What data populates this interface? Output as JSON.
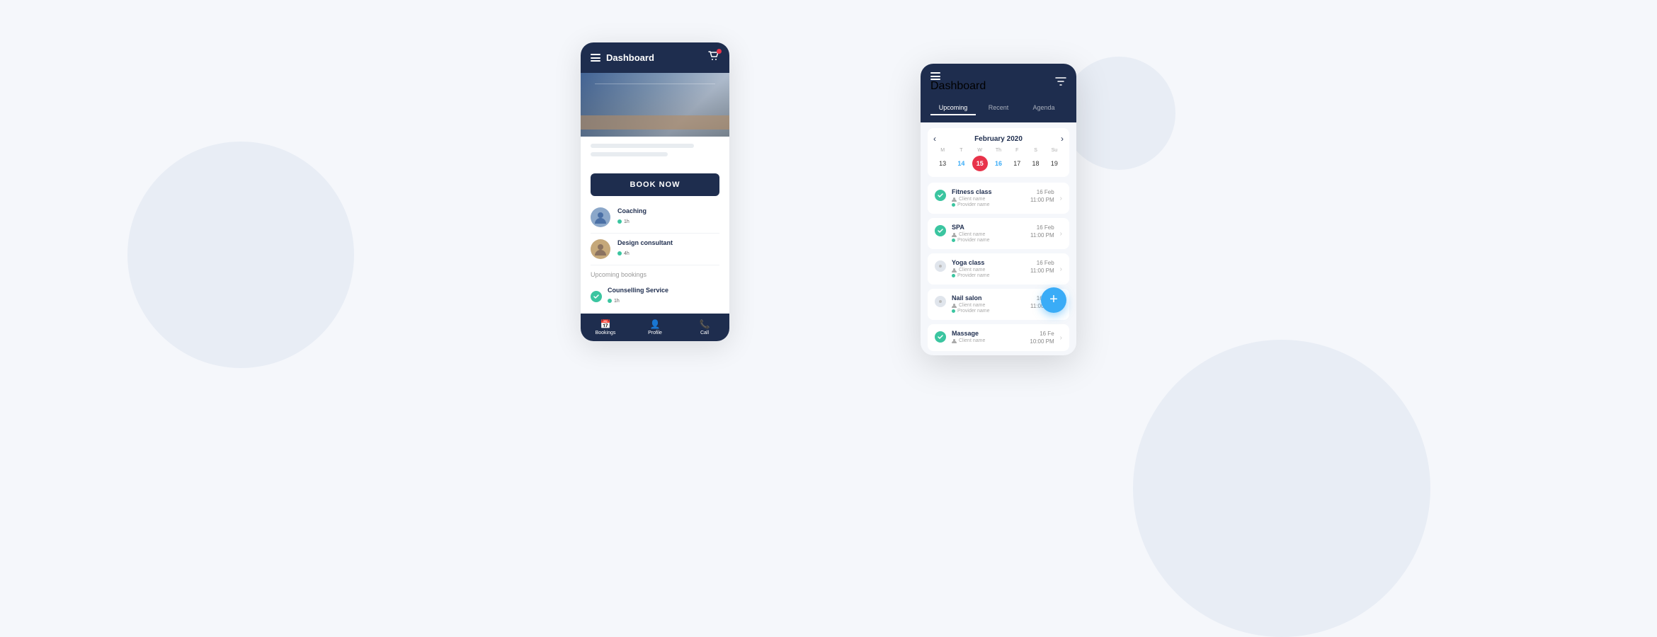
{
  "background": {
    "color": "#f5f7fb"
  },
  "phone_back": {
    "header": {
      "title": "Dashboard",
      "menu_label": "menu",
      "cart_label": "cart"
    },
    "book_now_button": "BOOK NOW",
    "services": [
      {
        "name": "Coaching",
        "badge": "1h",
        "has_avatar": true,
        "avatar_type": "person"
      },
      {
        "name": "Design consultant",
        "badge": "4h",
        "has_avatar": true,
        "avatar_type": "photo"
      }
    ],
    "upcoming_section": {
      "title": "Upcoming bookings",
      "items": [
        {
          "name": "Counselling Service",
          "badge": "1h"
        }
      ]
    },
    "bottom_nav": [
      {
        "icon": "📅",
        "label": "Bookings"
      },
      {
        "icon": "👤",
        "label": "Profile"
      },
      {
        "icon": "📞",
        "label": "Call"
      }
    ]
  },
  "phone_front": {
    "header": {
      "title": "Dashboard",
      "filter_label": "filter"
    },
    "tabs": [
      {
        "label": "Upcoming",
        "active": true
      },
      {
        "label": "Recent",
        "active": false
      },
      {
        "label": "Agenda",
        "active": false
      }
    ],
    "calendar": {
      "month": "February 2020",
      "day_headers": [
        "M",
        "T",
        "W",
        "Th",
        "F",
        "S",
        "Su"
      ],
      "days": [
        {
          "num": "13",
          "state": "normal"
        },
        {
          "num": "14",
          "state": "normal"
        },
        {
          "num": "15",
          "state": "today"
        },
        {
          "num": "16",
          "state": "highlighted"
        },
        {
          "num": "17",
          "state": "normal"
        },
        {
          "num": "18",
          "state": "normal"
        },
        {
          "num": "19",
          "state": "normal"
        }
      ]
    },
    "bookings": [
      {
        "name": "Fitness class",
        "client": "Client name",
        "provider": "Provider name",
        "date": "16 Feb",
        "time": "11:00 PM",
        "status": "confirmed"
      },
      {
        "name": "SPA",
        "client": "Client name",
        "provider": "Provider name",
        "date": "16 Feb",
        "time": "11:00 PM",
        "status": "confirmed"
      },
      {
        "name": "Yoga class",
        "client": "Client name",
        "provider": "Provider name",
        "date": "16 Feb",
        "time": "11:00 PM",
        "status": "pending"
      },
      {
        "name": "Nail salon",
        "client": "Client name",
        "provider": "Provider name",
        "date": "16 Feb",
        "time": "11:00 PM",
        "status": "pending"
      },
      {
        "name": "Massage",
        "client": "Client name",
        "provider": "",
        "date": "16 Fe",
        "time": "10:00 PM",
        "status": "confirmed"
      }
    ],
    "fab_label": "+"
  }
}
